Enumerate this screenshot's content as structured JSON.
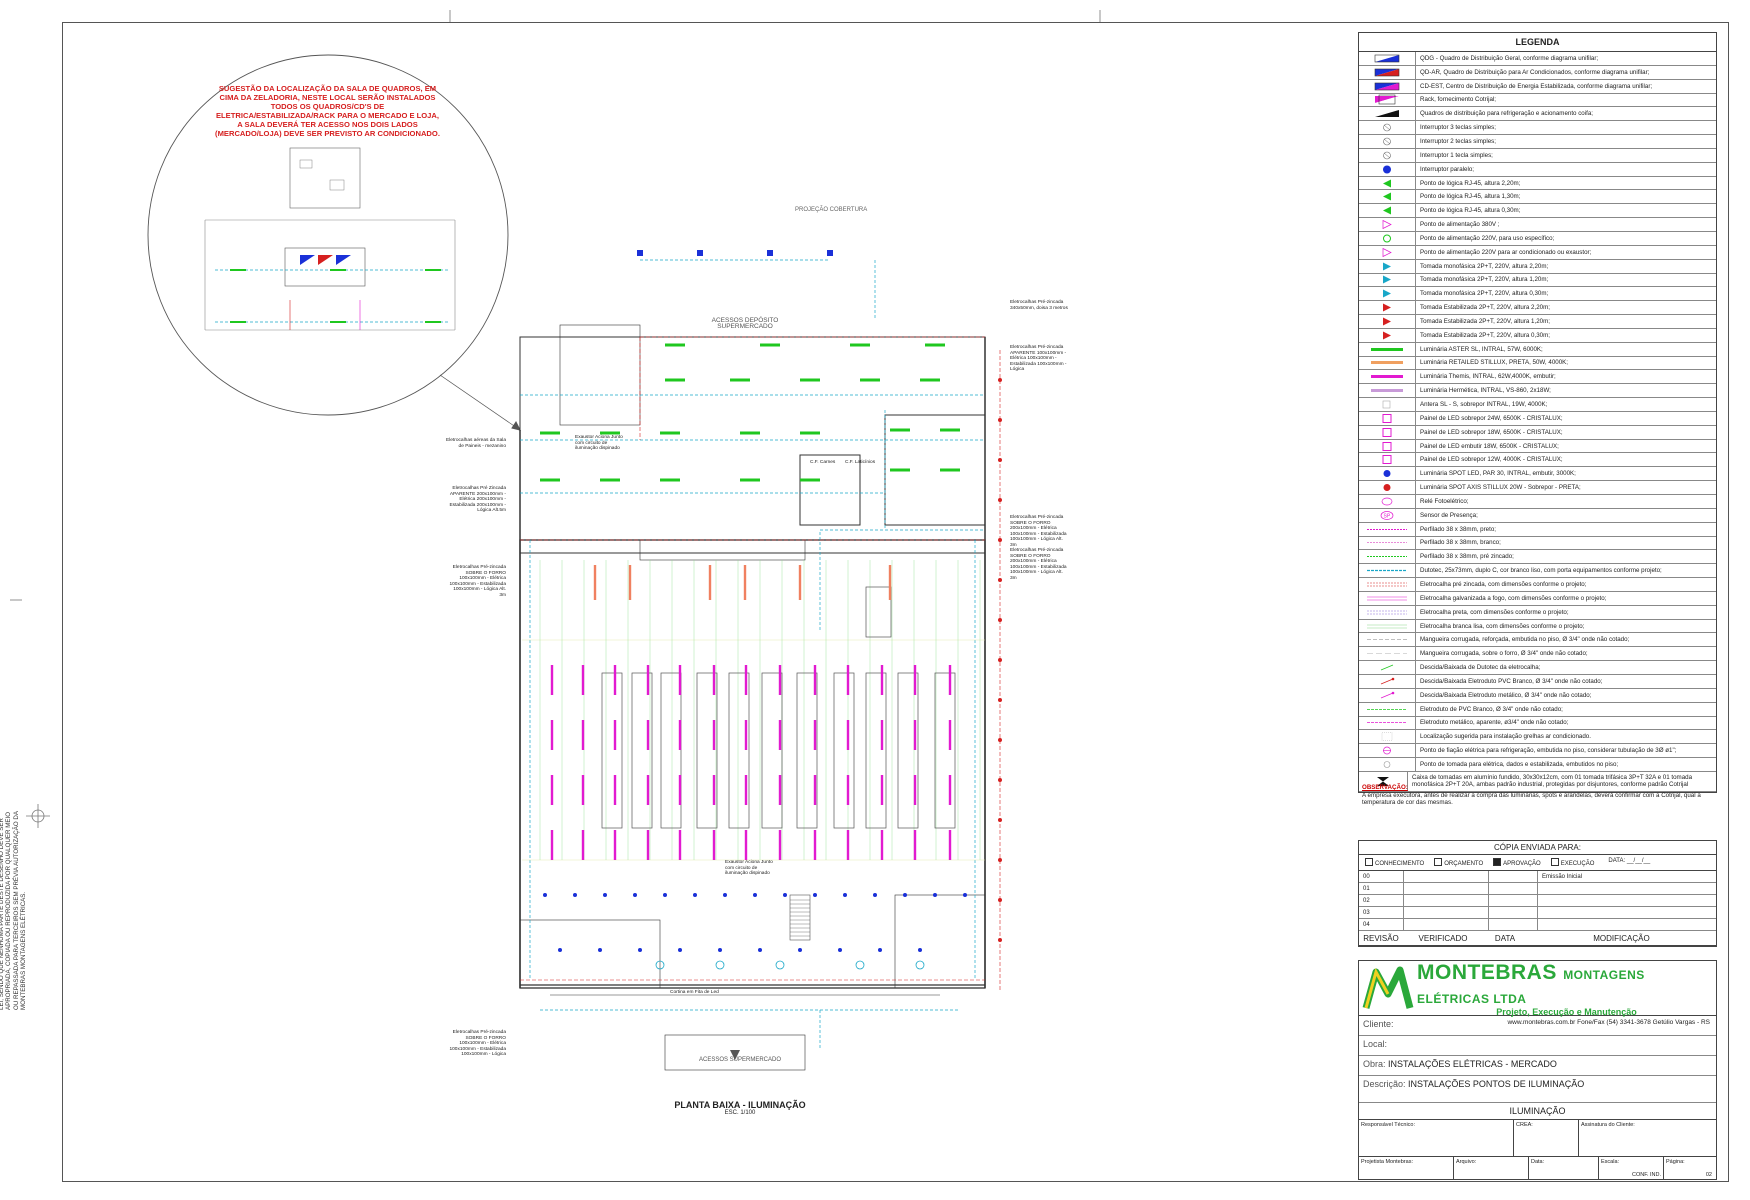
{
  "side_note": "TODOS OS DIREITOS ESTÃO RESERVADOS E PROTEGIDOS POR LEI, SENDO QUE NENHUMA PARTE DESTE DESENHO DEVE SER APROPRIADA, COPIADA OU REPRODUZIDA POR QUALQUER MEIO OU REPASSADA PARA TERCEIROS SEM PRÉVIA AUTORIZAÇÃO DA MONTEBRAS MONTAGENS ELÉTRICAS.",
  "callout_circle": "SUGESTÃO DA LOCALIZAÇÃO DA SALA DE QUADROS, EM CIMA DA ZELADORIA, NESTE LOCAL SERÃO INSTALADOS TODOS OS QUADROS/CD'S DE ELETRICA/ESTABILIZADA/RACK PARA O MERCADO E LOJA, A SALA DEVERÁ TER ACESSO NOS DOIS LADOS (MERCADO/LOJA) DEVE SER PREVISTO AR CONDICIONADO.",
  "plan_labels": {
    "projecao": "PROJEÇÃO COBERTURA",
    "acessos_deposito": "ACESSOS DEPÓSITO SUPERMERCADO",
    "acessos_super": "ACESSOS SUPERMERCADO",
    "cf_carnes": "C.F. Carnes",
    "cf_laticinios": "C.F. Laticínios",
    "cortina": "Cortina em Fita de Led",
    "exaustor1": "Exaustor Aciona Junto com circuito de iluminação dispinado",
    "exaustor2": "Exaustor Aciona Junto com circuito de iluminação dispinado",
    "ele_left1": "Eletrocalhas aéreas da Sala de Paineis - mezanino",
    "ele_left2": "Eletrocalhas Pré Zincada APARENTE 200x100mm - Elétrica 200x100mm - Estabilizada 200x100mm - Lógica Alt.5m",
    "ele_left3": "Eletrocalhas Pré-zincada SOBRE O FORRO 100x100mm - Elétrica 100x100mm - Estabilizada 100x100mm - Lógica Alt. 3m",
    "ele_left4": "Eletrocalhas Pré-zincada SOBRE O FORRO 100x100mm - Elétrica 100x100mm - Estabilizada 100x100mm - Lógica",
    "ele_right1": "Eletrocalhas Pré-zincada 340x50mm, doisa 3 metros",
    "ele_right2": "Eletrocalhas Pré-zincada APARENTE 100x100mm - Elétrica 100x100mm - Estabilizada 100x100mm - Lógica",
    "ele_right3": "Eletrocalhas Pré-zincada SOBRE O FORRO 200x100mm - Elétrica 100x100mm - Estabilizada 100x100mm - Lógica Alt. 3m",
    "ele_right4": "Eletrocalhas Pré-zincada SOBRE O FORRO 200x100mm - Elétrica 100x100mm - Estabilizada 100x100mm - Lógica Alt. 3m"
  },
  "plan_title": "PLANTA BAIXA - ILUMINAÇÃO",
  "plan_scale": "ESC. 1/100",
  "legend": {
    "title": "LEGENDA",
    "items": [
      {
        "sym": "qdg",
        "text": "QDG - Quadro de Distribuição Geral, conforme diagrama unifilar;"
      },
      {
        "sym": "qdar",
        "text": "QD-AR, Quadro de Distribuição para Ar Condicionados, conforme diagrama unifilar;"
      },
      {
        "sym": "cdest",
        "text": "CD-EST, Centro de Distribuição de Energia Estabilizada, conforme diagrama unifilar;"
      },
      {
        "sym": "rack",
        "text": "Rack, fornecimento Cotrijal;"
      },
      {
        "sym": "qref",
        "text": "Quadros de distribuição para refrigeração e acionamento coifa;"
      },
      {
        "sym": "int3",
        "text": "Interruptor 3 teclas simples;"
      },
      {
        "sym": "int2",
        "text": "Interruptor 2 teclas simples;"
      },
      {
        "sym": "int1",
        "text": "Interruptor 1 tecla simples;"
      },
      {
        "sym": "intp",
        "text": "Interruptor paralelo;"
      },
      {
        "sym": "rj1",
        "text": "Ponto de lógica RJ-45, altura 2,20m;"
      },
      {
        "sym": "rj2",
        "text": "Ponto de lógica RJ-45, altura 1,30m;"
      },
      {
        "sym": "rj3",
        "text": "Ponto de lógica RJ-45, altura 0,30m;"
      },
      {
        "sym": "al380",
        "text": "Ponto de alimentação 380V ;"
      },
      {
        "sym": "al220",
        "text": "Ponto de alimentação 220V, para uso específico;"
      },
      {
        "sym": "alar",
        "text": "Ponto de alimentação 220V para ar condicionado ou exaustor;"
      },
      {
        "sym": "tm1",
        "text": "Tomada monofásica 2P+T, 220V, altura 2,20m;"
      },
      {
        "sym": "tm2",
        "text": "Tomada monofásica 2P+T, 220V, altura 1,20m;"
      },
      {
        "sym": "tm3",
        "text": "Tomada monofásica 2P+T, 220V, altura 0,30m;"
      },
      {
        "sym": "te1",
        "text": "Tomada Estabilizada 2P+T, 220V, altura 2,20m;"
      },
      {
        "sym": "te2",
        "text": "Tomada Estabilizada 2P+T, 220V, altura 1,20m;"
      },
      {
        "sym": "te3",
        "text": "Tomada Estabilizada 2P+T, 220V, altura 0,30m;"
      },
      {
        "sym": "lum1",
        "text": "Luminária ASTER SL, INTRAL, 57W, 6000K;"
      },
      {
        "sym": "lum2",
        "text": "Luminária RETAILED STILLUX, PRETA, 50W, 4000K;"
      },
      {
        "sym": "lum3",
        "text": "Luminária Themis, INTRAL, 62W,4000K, embutir;"
      },
      {
        "sym": "lum4",
        "text": "Luminária Hermética, INTRAL, VS-860, 2x18W;"
      },
      {
        "sym": "ant",
        "text": "Antera SL - S, sobrepor INTRAL, 19W, 4000K;"
      },
      {
        "sym": "p24",
        "text": "Painel de LED sobrepor 24W, 6500K - CRISTALUX;"
      },
      {
        "sym": "p18",
        "text": "Painel de LED sobrepor 18W, 6500K - CRISTALUX;"
      },
      {
        "sym": "p18e",
        "text": "Painel de LED embutir 18W, 6500K - CRISTALUX;"
      },
      {
        "sym": "p12",
        "text": "Painel de LED sobrepor 12W, 4000K - CRISTALUX;"
      },
      {
        "sym": "spot1",
        "text": "Luminária SPOT LED, PAR 30, INTRAL, embutir, 3000K;"
      },
      {
        "sym": "spot2",
        "text": "Luminária SPOT AXIS STILLUX 20W - Sobrepor - PRETA;"
      },
      {
        "sym": "rele",
        "text": "Relé Fotoelétrico;"
      },
      {
        "sym": "sp",
        "text": "Sensor de Presença;"
      },
      {
        "sym": "pf1",
        "text": "Perfilado 38 x 38mm, preto;"
      },
      {
        "sym": "pf2",
        "text": "Perfilado 38 x 38mm, branco;"
      },
      {
        "sym": "pf3",
        "text": "Perfilado 38 x 38mm, pré zincado;"
      },
      {
        "sym": "dut",
        "text": "Dutotec, 25x73mm, duplo C, cor branco liso, com porta equipamentos conforme projeto;"
      },
      {
        "sym": "ec1",
        "text": "Eletrocalha pré zincada, com dimensões conforme o projeto;"
      },
      {
        "sym": "ec2",
        "text": "Eletrocalha galvanizada a fogo, com dimensões conforme o projeto;"
      },
      {
        "sym": "ec3",
        "text": "Eletrocalha preta, com dimensões conforme o projeto;"
      },
      {
        "sym": "ec4",
        "text": "Eletrocalha branca lisa, com dimensões conforme o projeto;"
      },
      {
        "sym": "mg1",
        "text": "Mangueira corrugada, reforçada, embutida no piso, Ø 3/4\" onde não cotado;"
      },
      {
        "sym": "mg2",
        "text": "Mangueira corrugada, sobre o forro, Ø 3/4\" onde não cotado;"
      },
      {
        "sym": "dd1",
        "text": "Descida/Baixada de Dutotec da eletrocalha;"
      },
      {
        "sym": "dd2",
        "text": "Descida/Baixada Eletroduto PVC Branco, Ø 3/4\" onde não cotado;"
      },
      {
        "sym": "dd3",
        "text": "Descida/Baixada Eletroduto metálico, Ø 3/4\" onde não cotado;"
      },
      {
        "sym": "el1",
        "text": "Eletroduto de PVC Branco, Ø 3/4\" onde não cotado;"
      },
      {
        "sym": "el2",
        "text": "Eletroduto metálico, aparente, ø3/4\" onde não cotado;"
      },
      {
        "sym": "loc",
        "text": "Localização sugerida para instalação grelhas ar condicionado."
      },
      {
        "sym": "fia",
        "text": "Ponto de fiação elétrica para refrigeração, embutida no piso, considerar tubulação de 3Ø ø1\";"
      },
      {
        "sym": "tom",
        "text": "Ponto de tomada para elétrica, dados e estabilizada, embutidos no piso;"
      },
      {
        "sym": "cx",
        "text": "Caixa de tomadas em alumínio fundido, 30x30x12cm, com 01 tomada trifásica 3P+T 32A e 01 tomada monofásica 2P+T 20A, ambas padrão industrial, protegidas por disjuntores, conforme padrão Cotrijal"
      }
    ]
  },
  "observacao": {
    "title": "OBSERVAÇÃO:",
    "text": "A empresa executora, antes de realizar a compra das luminárias, spots e arandelas, deverá confirmar com a Cotrijal, qual a temperatura de cor das mesmas."
  },
  "revisions": {
    "title": "CÓPIA ENVIADA PARA:",
    "options": [
      "CONHECIMENTO",
      "ORÇAMENTO",
      "APROVAÇÃO",
      "EXECUÇÃO"
    ],
    "checked": "APROVAÇÃO",
    "data_label": "DATA: __/__/__",
    "rows": [
      {
        "n": "00",
        "mod": "Emissão Inicial"
      },
      {
        "n": "01",
        "mod": ""
      },
      {
        "n": "02",
        "mod": ""
      },
      {
        "n": "03",
        "mod": ""
      },
      {
        "n": "04",
        "mod": ""
      }
    ],
    "headers": [
      "REVISÃO",
      "VERIFICADO",
      "DATA",
      "MODIFICAÇÃO"
    ]
  },
  "title_block": {
    "brand": "MONTEBRAS",
    "brand_sub": "MONTAGENS ELÉTRICAS LTDA",
    "tagline": "Projeto, Execução e Manutenção",
    "contact": "www.montebras.com.br    Fone/Fax (54) 3341-3678    Getúlio Vargas - RS",
    "cliente_label": "Cliente:",
    "local_label": "Local:",
    "obra_label": "Obra:",
    "obra": "INSTALAÇÕES ELÉTRICAS - MERCADO",
    "desc_label": "Descrição:",
    "desc": "INSTALAÇÕES PONTOS DE ILUMINAÇÃO",
    "sheet_name": "ILUMINAÇÃO",
    "resp": "Responsável Técnico:",
    "crea": "CREA:",
    "assinatura": "Assinatura do Cliente:",
    "projetista": "Projetista Montebras:",
    "arquivo": "Arquivo:",
    "data": "Data:",
    "escala": "Escala:",
    "pagina": "Página:",
    "conf": "CONF. IND.",
    "page_no": "02"
  },
  "colors": {
    "accent": "#2aa83a",
    "red": "#d62020",
    "magenta": "#e21ad0",
    "green": "#1fc71f",
    "blue": "#1a30d8",
    "cyan": "#19a7c8"
  }
}
